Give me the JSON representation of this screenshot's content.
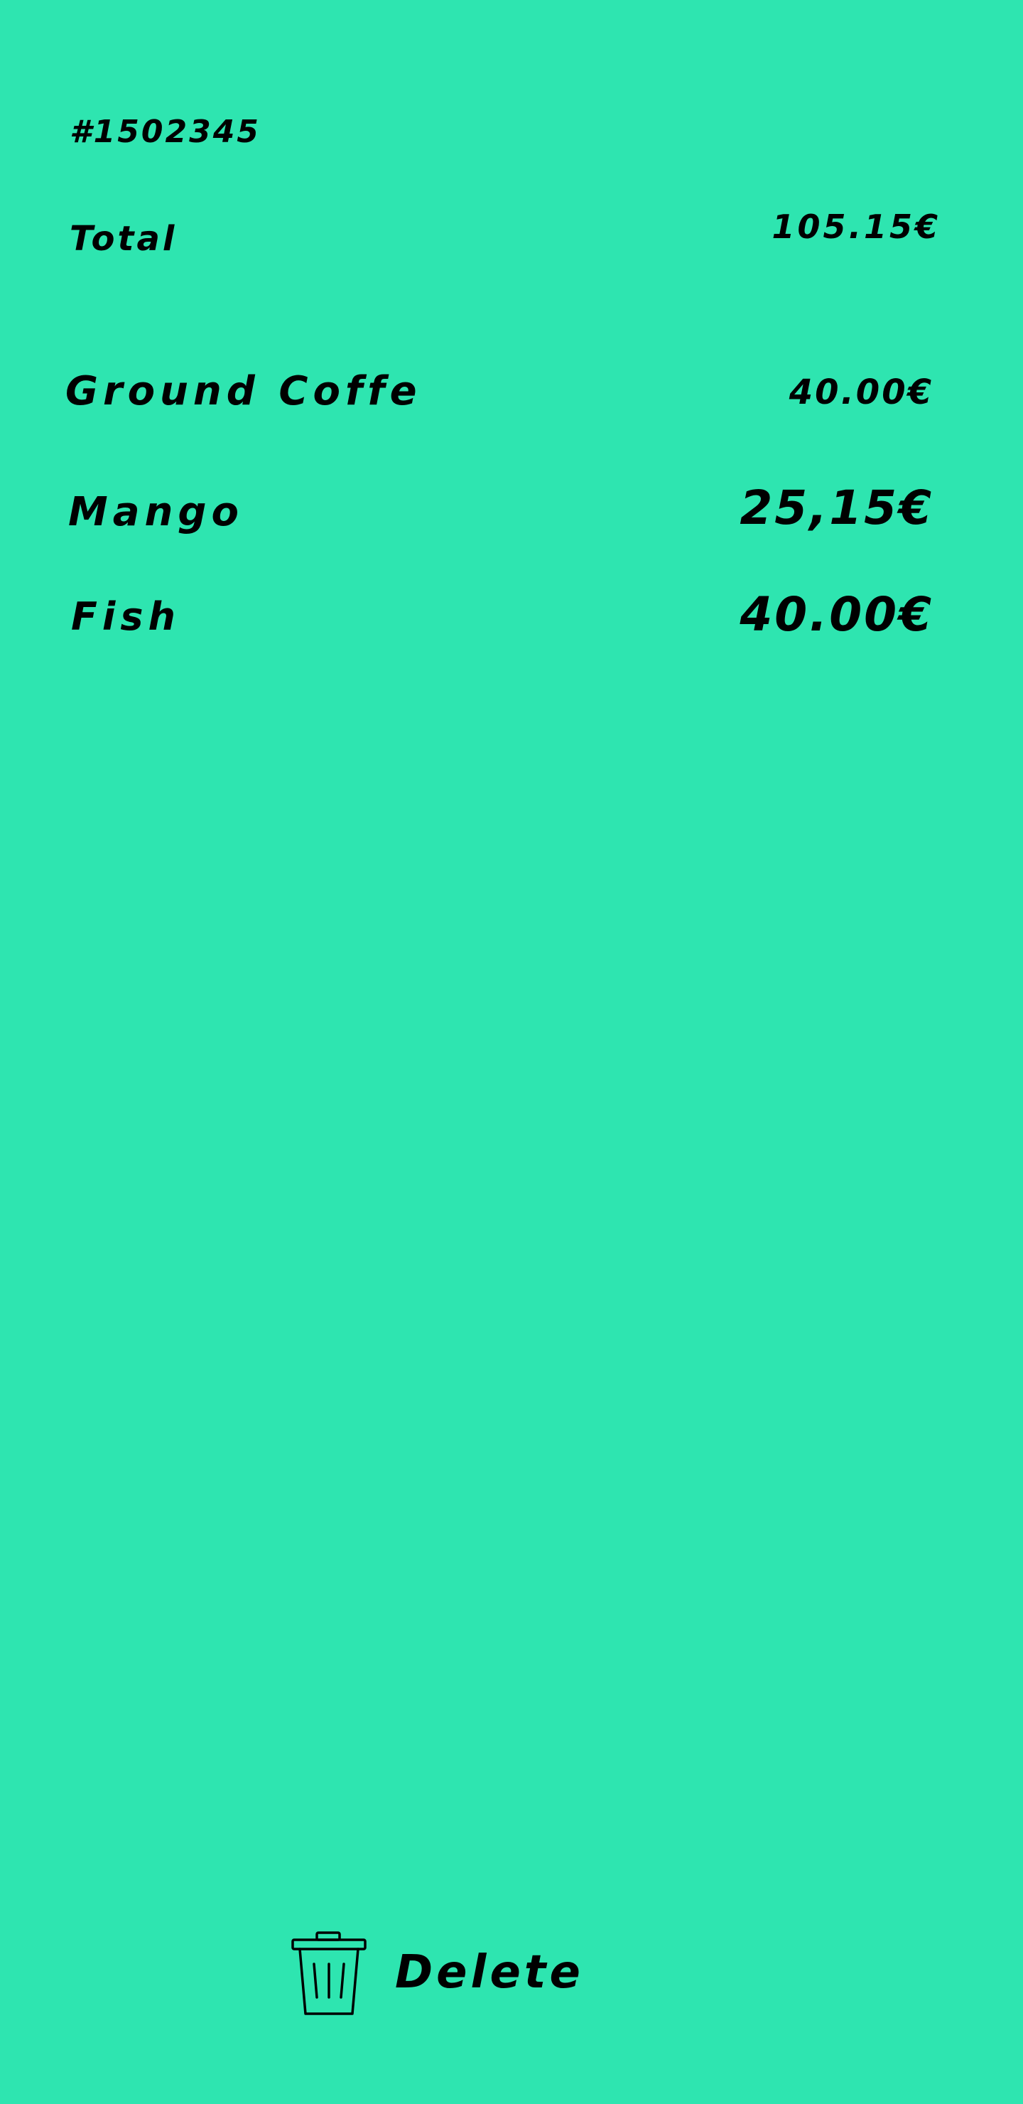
{
  "order": {
    "id": "#1502345",
    "total_label": "Total",
    "total_value": "105.15€"
  },
  "items": [
    {
      "name": "Ground Coffe",
      "price": "40.00€"
    },
    {
      "name": "Mango",
      "price": "25,15€"
    },
    {
      "name": "Fish",
      "price": "40.00€"
    }
  ],
  "actions": {
    "delete_label": "Delete",
    "delete_icon": "trash-icon"
  },
  "colors": {
    "background": "#2ee5b0",
    "text": "#000000"
  }
}
